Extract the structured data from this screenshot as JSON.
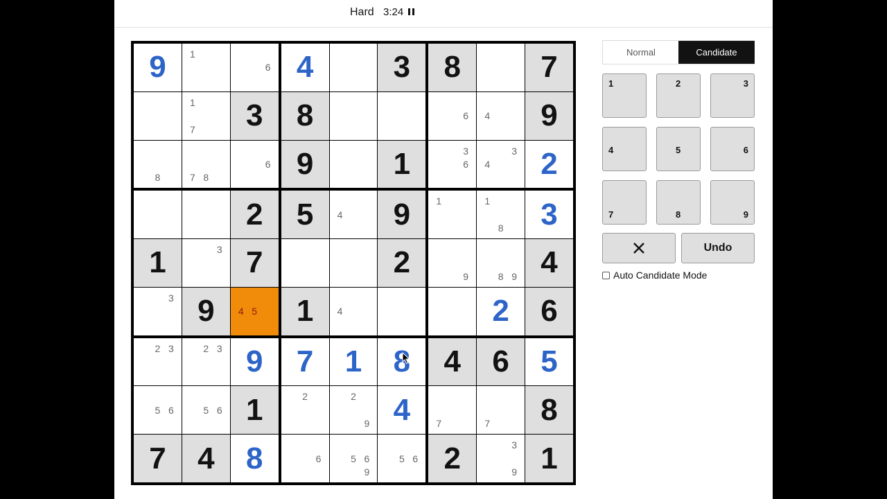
{
  "header": {
    "difficulty": "Hard",
    "timer": "3:24"
  },
  "icons": {
    "pause": "pause-icon",
    "erase": "x-icon",
    "cursor": "mouse-pointer-icon"
  },
  "colors": {
    "given_bg": "#dfdfdf",
    "solved_digit": "#2d64c8",
    "selected_bg": "#f08c0a",
    "candidate_mode_bg": "#121212"
  },
  "mode": {
    "normal_label": "Normal",
    "candidate_label": "Candidate",
    "active": "Candidate"
  },
  "keypad": [
    "1",
    "2",
    "3",
    "4",
    "5",
    "6",
    "7",
    "8",
    "9"
  ],
  "actions": {
    "erase_symbol": "✕",
    "undo_label": "Undo"
  },
  "auto_candidate": {
    "label": "Auto Candidate Mode",
    "checked": false
  },
  "selected_cell": {
    "row": 6,
    "col": 3
  },
  "board": [
    [
      {
        "type": "solved",
        "value": "9"
      },
      {
        "type": "empty",
        "cands": [
          "1"
        ]
      },
      {
        "type": "empty",
        "cands": [
          "6"
        ]
      },
      {
        "type": "solved",
        "value": "4"
      },
      {
        "type": "empty",
        "cands": []
      },
      {
        "type": "given",
        "value": "3"
      },
      {
        "type": "given",
        "value": "8"
      },
      {
        "type": "empty",
        "cands": []
      },
      {
        "type": "given",
        "value": "7"
      }
    ],
    [
      {
        "type": "empty",
        "cands": []
      },
      {
        "type": "empty",
        "cands": [
          "1",
          "7"
        ]
      },
      {
        "type": "given",
        "value": "3"
      },
      {
        "type": "given",
        "value": "8"
      },
      {
        "type": "empty",
        "cands": []
      },
      {
        "type": "empty",
        "cands": []
      },
      {
        "type": "empty",
        "cands": [
          "6"
        ]
      },
      {
        "type": "empty",
        "cands": [
          "4"
        ]
      },
      {
        "type": "given",
        "value": "9"
      }
    ],
    [
      {
        "type": "empty",
        "cands": [
          "8"
        ]
      },
      {
        "type": "empty",
        "cands": [
          "7",
          "8"
        ]
      },
      {
        "type": "empty",
        "cands": [
          "6"
        ]
      },
      {
        "type": "given",
        "value": "9"
      },
      {
        "type": "empty",
        "cands": []
      },
      {
        "type": "given",
        "value": "1"
      },
      {
        "type": "empty",
        "cands": [
          "3",
          "6"
        ]
      },
      {
        "type": "empty",
        "cands": [
          "3",
          "4"
        ]
      },
      {
        "type": "solved",
        "value": "2"
      }
    ],
    [
      {
        "type": "empty",
        "cands": []
      },
      {
        "type": "empty",
        "cands": []
      },
      {
        "type": "given",
        "value": "2"
      },
      {
        "type": "given",
        "value": "5"
      },
      {
        "type": "empty",
        "cands": [
          "4"
        ]
      },
      {
        "type": "given",
        "value": "9"
      },
      {
        "type": "empty",
        "cands": [
          "1"
        ]
      },
      {
        "type": "empty",
        "cands": [
          "1",
          "8"
        ]
      },
      {
        "type": "solved",
        "value": "3"
      }
    ],
    [
      {
        "type": "given",
        "value": "1"
      },
      {
        "type": "empty",
        "cands": [
          "3"
        ]
      },
      {
        "type": "given",
        "value": "7"
      },
      {
        "type": "empty",
        "cands": []
      },
      {
        "type": "empty",
        "cands": []
      },
      {
        "type": "given",
        "value": "2"
      },
      {
        "type": "empty",
        "cands": [
          "9"
        ]
      },
      {
        "type": "empty",
        "cands": [
          "8",
          "9"
        ]
      },
      {
        "type": "given",
        "value": "4"
      }
    ],
    [
      {
        "type": "empty",
        "cands": [
          "3"
        ]
      },
      {
        "type": "given",
        "value": "9"
      },
      {
        "type": "selected",
        "cands": [
          "4",
          "5"
        ]
      },
      {
        "type": "given",
        "value": "1"
      },
      {
        "type": "empty",
        "cands": [
          "4"
        ]
      },
      {
        "type": "empty",
        "cands": []
      },
      {
        "type": "empty",
        "cands": []
      },
      {
        "type": "solved",
        "value": "2"
      },
      {
        "type": "given",
        "value": "6"
      }
    ],
    [
      {
        "type": "empty",
        "cands": [
          "2",
          "3"
        ]
      },
      {
        "type": "empty",
        "cands": [
          "2",
          "3"
        ]
      },
      {
        "type": "solved",
        "value": "9"
      },
      {
        "type": "solved",
        "value": "7"
      },
      {
        "type": "solved",
        "value": "1"
      },
      {
        "type": "solved",
        "value": "8"
      },
      {
        "type": "given",
        "value": "4"
      },
      {
        "type": "given",
        "value": "6"
      },
      {
        "type": "solved",
        "value": "5"
      }
    ],
    [
      {
        "type": "empty",
        "cands": [
          "5",
          "6"
        ]
      },
      {
        "type": "empty",
        "cands": [
          "5",
          "6"
        ]
      },
      {
        "type": "given",
        "value": "1"
      },
      {
        "type": "empty",
        "cands": [
          "2"
        ]
      },
      {
        "type": "empty",
        "cands": [
          "2",
          "9"
        ]
      },
      {
        "type": "solved",
        "value": "4"
      },
      {
        "type": "empty",
        "cands": [
          "7"
        ]
      },
      {
        "type": "empty",
        "cands": [
          "7"
        ]
      },
      {
        "type": "given",
        "value": "8"
      }
    ],
    [
      {
        "type": "given",
        "value": "7"
      },
      {
        "type": "given",
        "value": "4"
      },
      {
        "type": "solved",
        "value": "8"
      },
      {
        "type": "empty",
        "cands": [
          "6"
        ]
      },
      {
        "type": "empty",
        "cands": [
          "5",
          "6",
          "9"
        ]
      },
      {
        "type": "empty",
        "cands": [
          "5",
          "6"
        ]
      },
      {
        "type": "given",
        "value": "2"
      },
      {
        "type": "empty",
        "cands": [
          "3",
          "9"
        ]
      },
      {
        "type": "given",
        "value": "1"
      }
    ]
  ]
}
